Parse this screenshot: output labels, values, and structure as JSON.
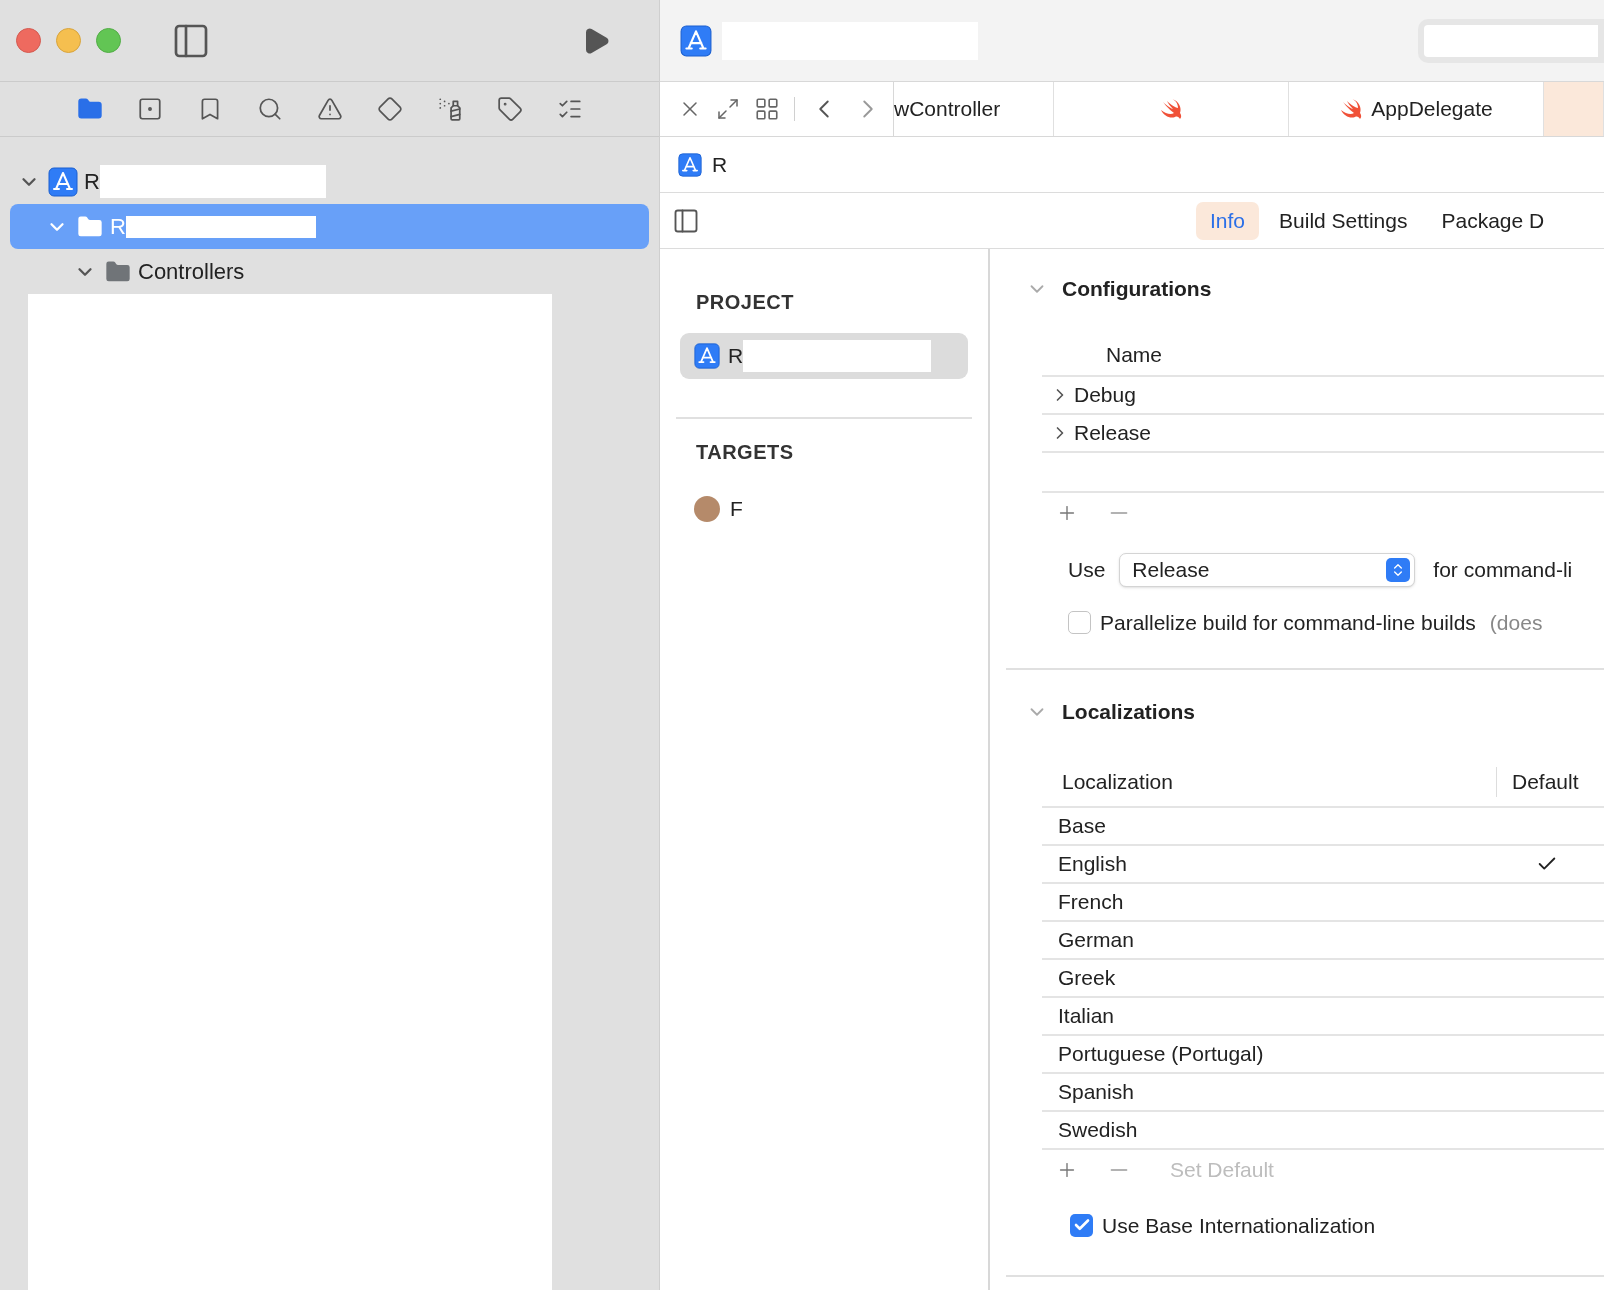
{
  "navigator": {
    "toolbar": [
      {
        "kind": "folder",
        "selected": true
      },
      {
        "kind": "source",
        "selected": false
      },
      {
        "kind": "bookmark",
        "selected": false
      },
      {
        "kind": "search",
        "selected": false
      },
      {
        "kind": "warning",
        "selected": false
      },
      {
        "kind": "test",
        "selected": false
      },
      {
        "kind": "debug",
        "selected": false
      },
      {
        "kind": "tag",
        "selected": false
      },
      {
        "kind": "report",
        "selected": false
      }
    ],
    "tree": [
      {
        "label": "R",
        "expanded": true,
        "selected": false,
        "children": [
          {
            "label": "R",
            "expanded": true,
            "selected": true,
            "children": [
              {
                "label": "Controllers",
                "expanded": true,
                "selected": false
              }
            ]
          }
        ]
      }
    ]
  },
  "editor_tabs": [
    {
      "label": "wController",
      "swift": false,
      "selected": false
    },
    {
      "swift": true,
      "selected": false
    },
    {
      "label": "AppDelegate",
      "swift": true,
      "selected": false
    },
    {
      "swift": false,
      "selected": true
    }
  ],
  "jump_bar": {
    "label": "R"
  },
  "section_tabs": [
    {
      "label": "Info",
      "selected": true
    },
    {
      "label": "Build Settings",
      "selected": false
    },
    {
      "label": "Package D",
      "selected": false
    }
  ],
  "project_list": {
    "project_heading": "PROJECT",
    "projects": [
      {
        "label": "R",
        "selected": true
      }
    ],
    "targets_heading": "TARGETS",
    "targets": [
      {
        "label": "F",
        "selected": false
      }
    ]
  },
  "configurations": {
    "title": "Configurations",
    "expanded": true,
    "column": "Name",
    "rows": [
      {
        "label": "Debug",
        "expanded": false
      },
      {
        "label": "Release",
        "expanded": false
      }
    ],
    "use_label": "Use",
    "use_value": "Release",
    "use_suffix": "for command-li",
    "parallelize": {
      "label": "Parallelize build for command-line builds",
      "checked": false,
      "note": "(does"
    }
  },
  "localizations": {
    "title": "Localizations",
    "expanded": true,
    "columns": [
      "Localization",
      "Default"
    ],
    "rows": [
      {
        "label": "Base",
        "default": false
      },
      {
        "label": "English",
        "default": true
      },
      {
        "label": "French",
        "default": false
      },
      {
        "label": "German",
        "default": false
      },
      {
        "label": "Greek",
        "default": false
      },
      {
        "label": "Italian",
        "default": false
      },
      {
        "label": "Portuguese (Portugal)",
        "default": false
      },
      {
        "label": "Spanish",
        "default": false
      },
      {
        "label": "Swedish",
        "default": false
      }
    ],
    "set_default": {
      "label": "Set Default",
      "disabled": true
    },
    "base_internationalization": {
      "label": "Use Base Internationalization",
      "checked": true
    }
  }
}
